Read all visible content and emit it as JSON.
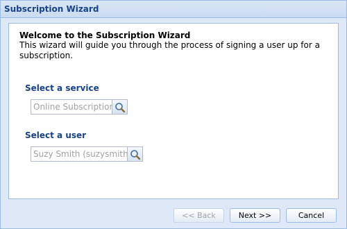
{
  "window": {
    "title": "Subscription Wizard"
  },
  "welcome": {
    "title": "Welcome to the Subscription Wizard",
    "text": "This wizard will guide you through the process of signing a user up for a subscription."
  },
  "service": {
    "label": "Select a service",
    "placeholder": "Online Subscription",
    "trigger_icon": "search-icon"
  },
  "user": {
    "label": "Select a user",
    "placeholder": "Suzy Smith (suzysmith)",
    "trigger_icon": "search-icon"
  },
  "buttons": {
    "back": "<< Back",
    "next": "Next >>",
    "cancel": "Cancel"
  },
  "colors": {
    "header_text": "#15428b",
    "border": "#99bbe8",
    "window_bg": "#dfe8f6"
  }
}
